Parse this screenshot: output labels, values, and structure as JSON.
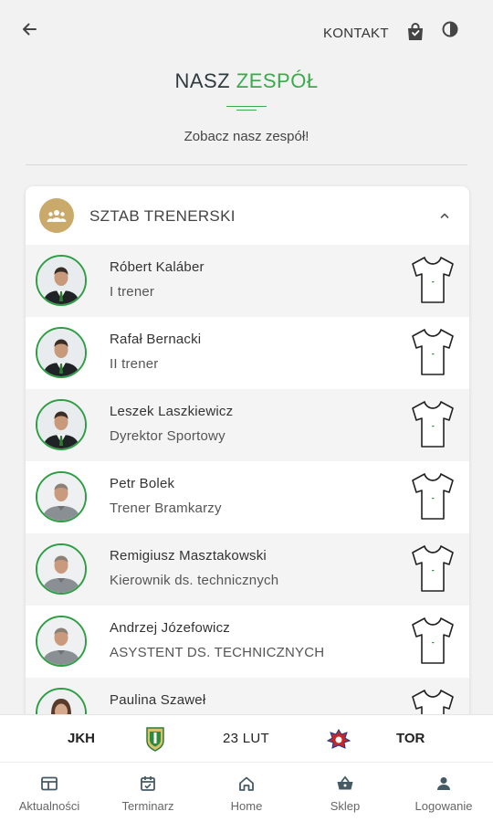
{
  "header": {
    "contact_label": "KONTAKT"
  },
  "page": {
    "title_part1": "NASZ",
    "title_part2": "ZESPÓŁ",
    "subtitle": "Zobacz nasz zespół!"
  },
  "panel": {
    "title": "SZTAB TRENERSKI",
    "badge_color": "#c9aa6b",
    "staff": [
      {
        "name": "Róbert Kaláber",
        "role": "I trener",
        "avatar": "suit"
      },
      {
        "name": "Rafał Bernacki",
        "role": "II trener",
        "avatar": "suit"
      },
      {
        "name": "Leszek Laszkiewicz",
        "role": "Dyrektor Sportowy",
        "avatar": "suit"
      },
      {
        "name": "Petr Bolek",
        "role": "Trener Bramkarzy",
        "avatar": "grey-shirt"
      },
      {
        "name": "Remigiusz Masztakowski",
        "role": "Kierownik ds. technicznych",
        "avatar": "grey-shirt"
      },
      {
        "name": "Andrzej Józefowicz",
        "role": "ASYSTENT DS. TECHNICZNYCH",
        "avatar": "grey-shirt"
      },
      {
        "name": "Paulina Szaweł",
        "role": "",
        "avatar": "woman"
      }
    ]
  },
  "match": {
    "home_team": "JKH",
    "date": "23 LUT",
    "away_team": "TOR"
  },
  "nav": {
    "items": [
      {
        "label": "Aktualności",
        "icon": "news-icon"
      },
      {
        "label": "Terminarz",
        "icon": "calendar-icon"
      },
      {
        "label": "Home",
        "icon": "home-icon"
      },
      {
        "label": "Sklep",
        "icon": "basket-icon"
      },
      {
        "label": "Logowanie",
        "icon": "user-icon"
      }
    ]
  },
  "colors": {
    "accent_green": "#3aaa4a",
    "avatar_ring": "#2e9e45",
    "background": "#f2f2f2"
  }
}
